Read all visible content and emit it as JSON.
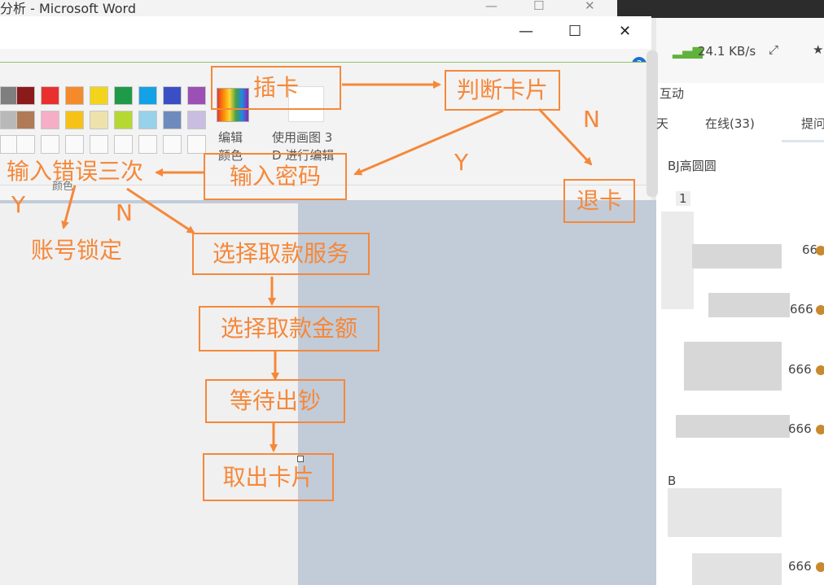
{
  "word_window": {
    "title": "分析 - Microsoft Word"
  },
  "paint_window": {
    "ribbon": {
      "edit_colors_line1": "编辑",
      "edit_colors_line2": "颜色",
      "paint3d_line1": "使用画图 3",
      "paint3d_line2": "D 进行编辑",
      "colors_group_label": "颜色"
    }
  },
  "chat_panel": {
    "speed": "24.1 KB/s",
    "tab_interact": "互动",
    "tab_day": "天",
    "tab_online": "在线(33)",
    "tab_remind": "提问",
    "user1": "BJ高圆圆",
    "user1_count": "1",
    "msg1": "66",
    "msg2": "666",
    "msg3": "666",
    "msg4": "666",
    "user2": "B",
    "msg5": "666"
  },
  "flowchart": {
    "nodes": {
      "insert_card": "插卡",
      "check_card": "判断卡片",
      "eject_card": "退卡",
      "enter_password": "输入密码",
      "wrong_three_times": "输入错误三次",
      "account_locked": "账号锁定",
      "select_withdraw_service": "选择取款服务",
      "select_amount": "选择取款金额",
      "wait_cash": "等待出钞",
      "take_card": "取出卡片"
    },
    "edge_labels": {
      "check_no": "N",
      "check_yes": "Y",
      "wrong_yes": "Y",
      "wrong_no": "N"
    },
    "colors": {
      "stroke": "#f5883a"
    }
  }
}
